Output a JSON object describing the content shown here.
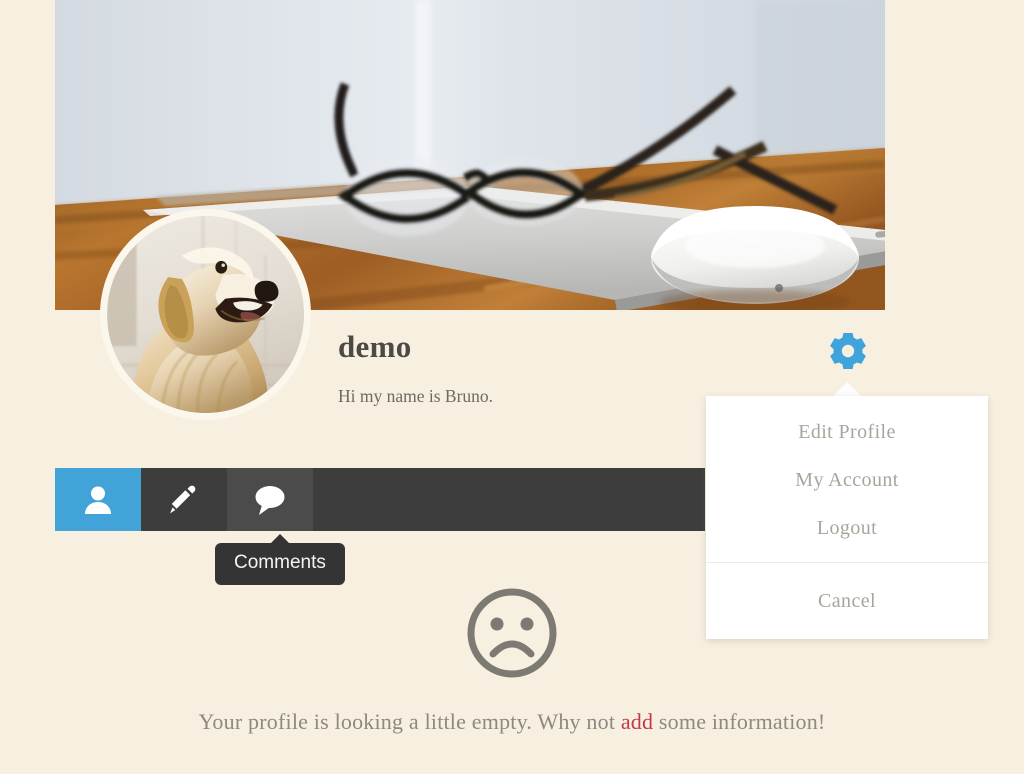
{
  "theme": {
    "page_background": "#f7f0e1",
    "accent_blue": "#41a3d8",
    "tabbar_dark": "#3d3d3d",
    "tab_hover": "#4b4b4b",
    "tooltip_background": "#343434",
    "link_red": "#c0394b",
    "muted_text": "#8d8880",
    "dropdown_text": "#a9a49c"
  },
  "cover": {
    "icon": "cover-photo",
    "alt": "Eyeglasses resting on a laptop with a white mouse on a wooden desk"
  },
  "profile": {
    "avatar_icon": "avatar-photo",
    "avatar_alt": "Golden retriever dog portrait",
    "username": "demo",
    "bio": "Hi my name is Bruno."
  },
  "settings": {
    "gear_icon": "gear-icon",
    "caret_icon": "caret-up-icon",
    "menu": {
      "primary": [
        {
          "label": "Edit Profile",
          "name": "edit-profile"
        },
        {
          "label": "My Account",
          "name": "my-account"
        },
        {
          "label": "Logout",
          "name": "logout"
        }
      ],
      "secondary": [
        {
          "label": "Cancel",
          "name": "cancel"
        }
      ]
    }
  },
  "tabs": [
    {
      "label": "Profile",
      "icon": "user-icon",
      "state": "active"
    },
    {
      "label": "Edit",
      "icon": "pencil-icon",
      "state": "default"
    },
    {
      "label": "Comments",
      "icon": "comment-bubble-icon",
      "state": "hover"
    }
  ],
  "tooltip": {
    "label": "Comments"
  },
  "empty_state": {
    "icon": "frowning-face-icon",
    "text_before": "Your profile is looking a little empty. Why not ",
    "link_text": "add",
    "text_after": " some information!"
  }
}
